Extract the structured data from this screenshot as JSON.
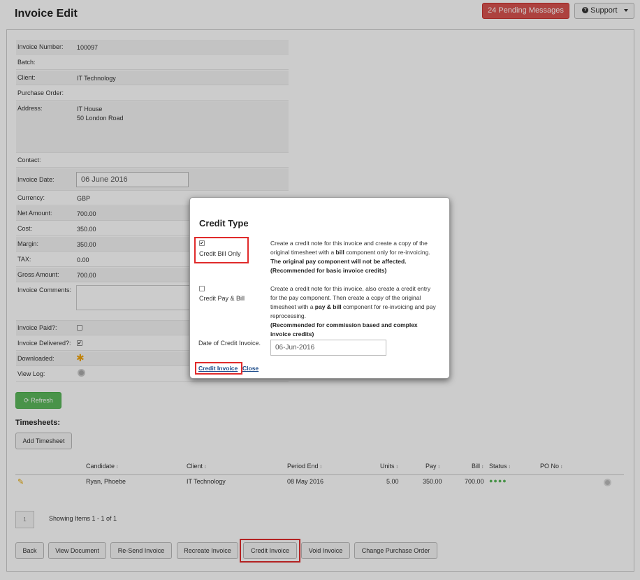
{
  "header": {
    "title": "Invoice Edit",
    "pending_messages": "24 Pending Messages",
    "support_label": "Support"
  },
  "form": {
    "invoice_number": {
      "label": "Invoice Number:",
      "value": "100097"
    },
    "batch": {
      "label": "Batch:",
      "value": ""
    },
    "client": {
      "label": "Client:",
      "value": "IT Technology"
    },
    "purchase_order": {
      "label": "Purchase Order:",
      "value": ""
    },
    "address": {
      "label": "Address:",
      "line1": "IT House",
      "line2": "50 London Road"
    },
    "contact": {
      "label": "Contact:",
      "value": ""
    },
    "invoice_date": {
      "label": "Invoice Date:",
      "value": "06 June 2016"
    },
    "currency": {
      "label": "Currency:",
      "value": "GBP"
    },
    "net_amount": {
      "label": "Net Amount:",
      "value": "700.00"
    },
    "cost": {
      "label": "Cost:",
      "value": "350.00"
    },
    "margin": {
      "label": "Margin:",
      "value": "350.00"
    },
    "tax": {
      "label": "TAX:",
      "value": "0.00"
    },
    "gross_amount": {
      "label": "Gross Amount:",
      "value": "700.00"
    },
    "invoice_comments": {
      "label": "Invoice Comments:",
      "value": ""
    },
    "invoice_paid": {
      "label": "Invoice Paid?:",
      "checked": false
    },
    "invoice_delivered": {
      "label": "Invoice Delivered?:",
      "checked": true,
      "mark": "✔"
    },
    "downloaded": {
      "label": "Downloaded:",
      "icon": "star-icon"
    },
    "view_log": {
      "label": "View Log:",
      "icon": "gear-icon"
    }
  },
  "refresh_label": "Refresh",
  "timesheets": {
    "heading": "Timesheets:",
    "add_label": "Add Timesheet",
    "columns": {
      "candidate": "Candidate",
      "client": "Client",
      "period_end": "Period End",
      "units": "Units",
      "pay": "Pay",
      "bill": "Bill",
      "status": "Status",
      "po_no": "PO No"
    },
    "rows": [
      {
        "candidate": "Ryan, Phoebe",
        "client": "IT Technology",
        "period_end": "08 May 2016",
        "units": "5.00",
        "pay": "350.00",
        "bill": "700.00",
        "status": "●●●●",
        "po_no": ""
      }
    ],
    "pager": {
      "page": "1",
      "showing": "Showing Items 1 - 1 of 1"
    }
  },
  "actions": {
    "back": "Back",
    "view_document": "View Document",
    "resend_invoice": "Re-Send Invoice",
    "recreate_invoice": "Recreate Invoice",
    "credit_invoice": "Credit Invoice",
    "void_invoice": "Void Invoice",
    "change_po": "Change Purchase Order"
  },
  "modal": {
    "title": "Credit Type",
    "option1": {
      "label": "Credit Bill Only",
      "checked": true,
      "mark": "✔",
      "desc_a": "Create a credit note for this invoice and create a copy of the original timesheet with a ",
      "desc_bold": "bill",
      "desc_b": " component only for re-invoicing.",
      "note1": "The original pay component will not be affected.",
      "note2": "(Recommended for basic invoice credits)"
    },
    "option2": {
      "label": "Credit Pay & Bill",
      "checked": false,
      "desc_a": "Create a credit note for this invoice, also create a credit entry for the pay component. Then create a copy of the original timesheet with a ",
      "desc_bold": "pay & bill",
      "desc_b": " component for re-invoicing and pay reprocessing.",
      "note": "(Recommended for commission based and complex invoice credits)"
    },
    "credit_date": {
      "label": "Date of Credit Invoice.",
      "value": "06-Jun-2016"
    },
    "credit_link": "Credit Invoice",
    "close_link": "Close"
  },
  "colors": {
    "danger": "#d9534f",
    "success": "#5cb85c",
    "highlight": "#e02b2b"
  }
}
